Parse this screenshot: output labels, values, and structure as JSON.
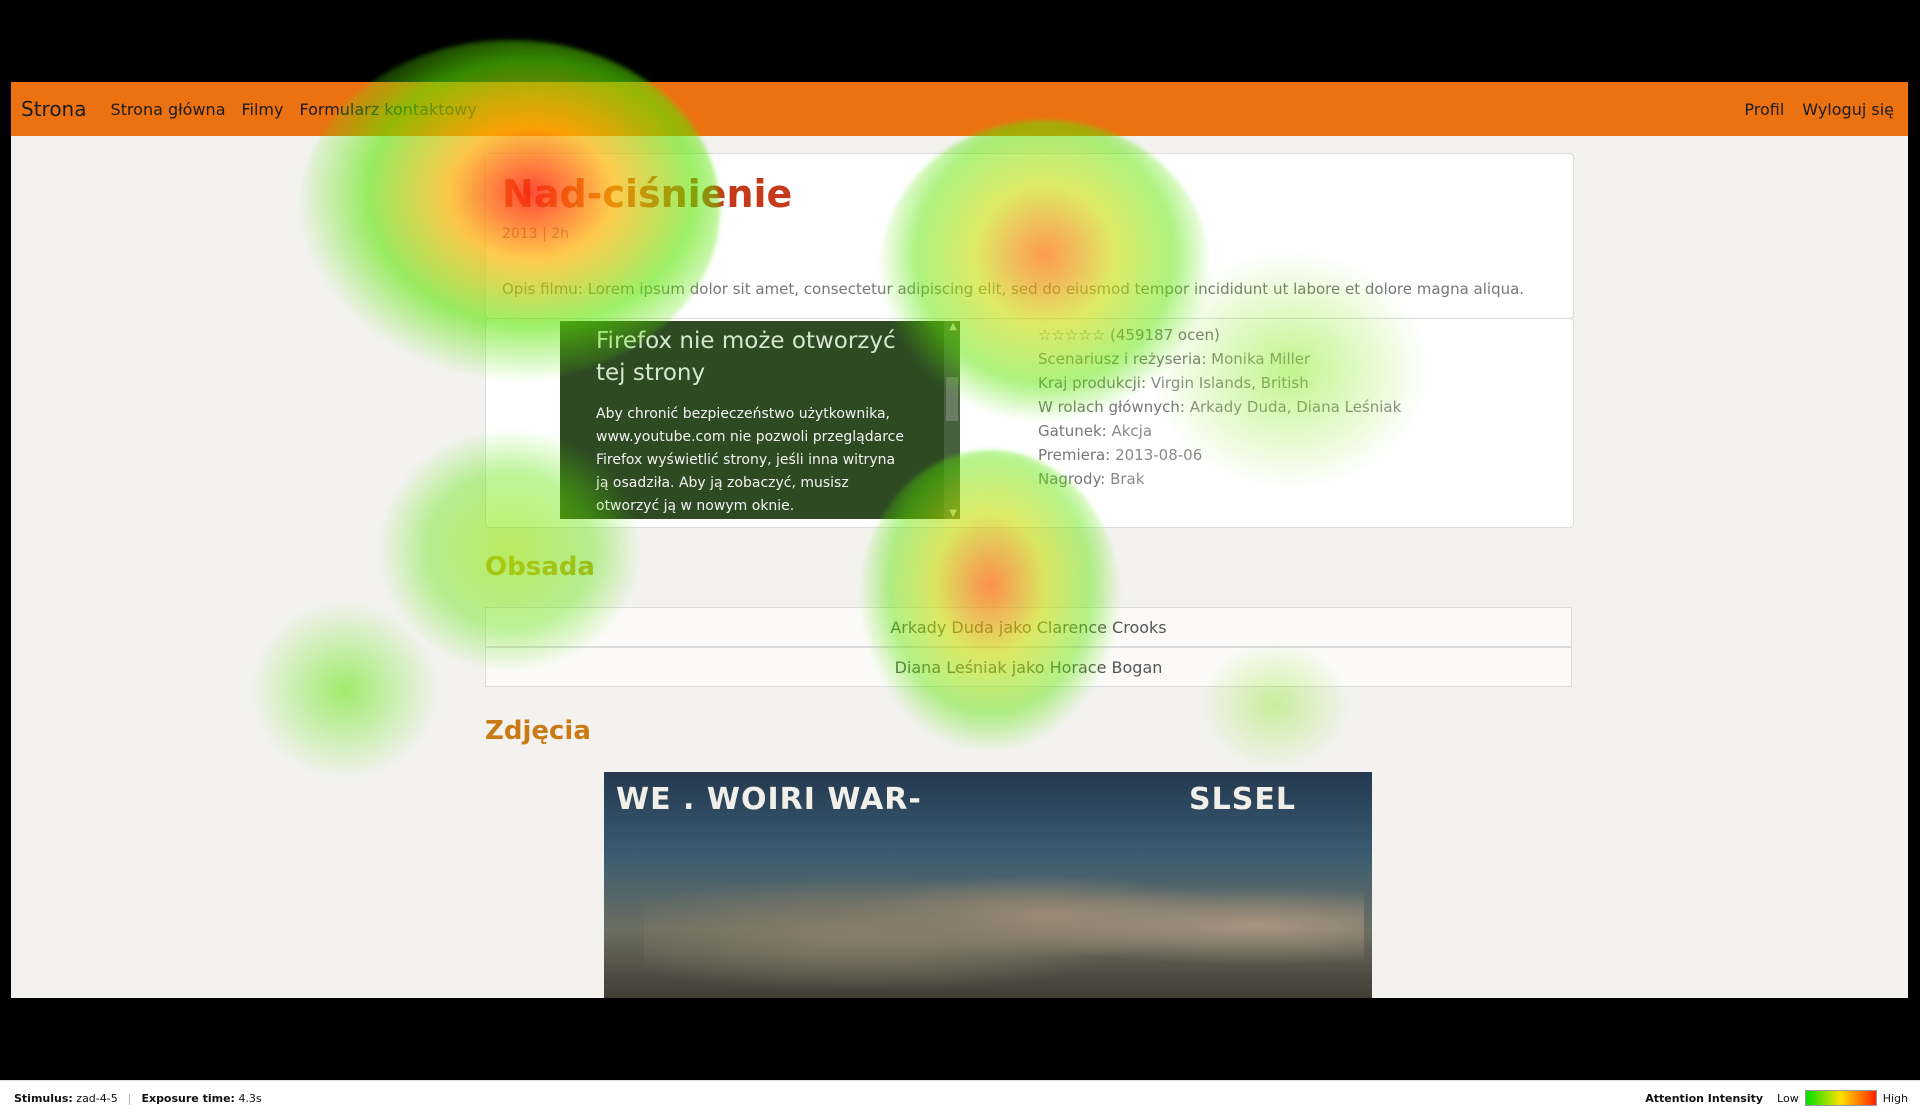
{
  "navbar": {
    "brand": "Strona",
    "links": [
      "Strona główna",
      "Filmy",
      "Formularz kontaktowy"
    ],
    "right_links": [
      "Profil",
      "Wyloguj się"
    ],
    "color": "#ec7211"
  },
  "movie": {
    "title": "Nad-ciśnienie",
    "meta": "2013 | 2h",
    "description": "Opis filmu: Lorem ipsum dolor sit amet, consectetur adipiscing elit, sed do eiusmod tempor incididunt ut labore et dolore magna aliqua."
  },
  "embed_error": {
    "heading": "Firefox nie może otworzyć tej strony",
    "body": "Aby chronić bezpieczeństwo użytkownika, www.youtube.com nie pozwoli przeglądarce Firefox wyświetlić strony, jeśli inna witryna ją osadziła. Aby ją zobaczyć, musisz otworzyć ją w nowym oknie."
  },
  "details": {
    "rating": "☆☆☆☆☆ (459187 ocen)",
    "writer_label": "Scenariusz i reżyseria:",
    "writer": "Monika Miller",
    "country_label": "Kraj produkcji:",
    "country": "Virgin Islands, British",
    "cast_label": "W rolach głównych:",
    "cast": "Arkady Duda, Diana Leśniak",
    "genre_label": "Gatunek:",
    "genre": "Akcja",
    "premiere_label": "Premiera:",
    "premiere": "2013-08-06",
    "awards_label": "Nagrody:",
    "awards": "Brak"
  },
  "cast_section": {
    "heading": "Obsada",
    "rows": [
      "Arkady Duda jako Clarence Crooks",
      "Diana Leśniak jako Horace Bogan"
    ]
  },
  "photos_section": {
    "heading": "Zdjęcia",
    "poster_text_left": "WE . WOIRI WAR-",
    "poster_text_right": "SLSEL"
  },
  "footer": {
    "stimulus_label": "Stimulus:",
    "stimulus": "zad-4-5",
    "exposure_label": "Exposure time:",
    "exposure": "4.3s",
    "legend_title": "Attention Intensity",
    "legend_low": "Low",
    "legend_high": "High"
  }
}
